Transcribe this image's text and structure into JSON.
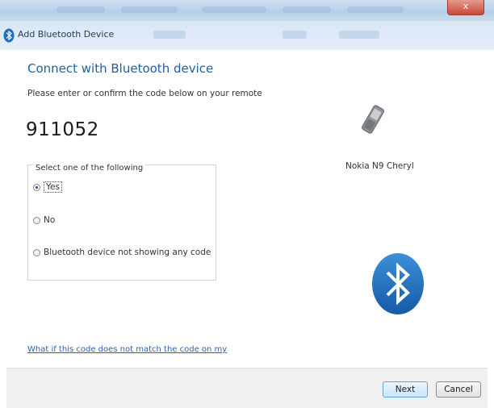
{
  "window": {
    "title": "Add Bluetooth Device",
    "close_label": "x"
  },
  "main": {
    "heading": "Connect with Bluetooth device",
    "instruction": "Please enter or confirm the code below on your remote",
    "code": "911052",
    "group_label": "Select one of the following",
    "options": [
      {
        "label": "Yes",
        "checked": true
      },
      {
        "label": "No",
        "checked": false
      },
      {
        "label": "Bluetooth device not showing any code",
        "checked": false
      }
    ],
    "help_link": "What if this code does not match the code on my"
  },
  "device": {
    "name": "Nokia N9  Cheryl",
    "icon": "phone-icon"
  },
  "footer": {
    "next_label": "Next",
    "cancel_label": "Cancel"
  },
  "colors": {
    "heading": "#1e5fa8",
    "link": "#2a63b0",
    "bluetooth": "#1e6fc0"
  }
}
